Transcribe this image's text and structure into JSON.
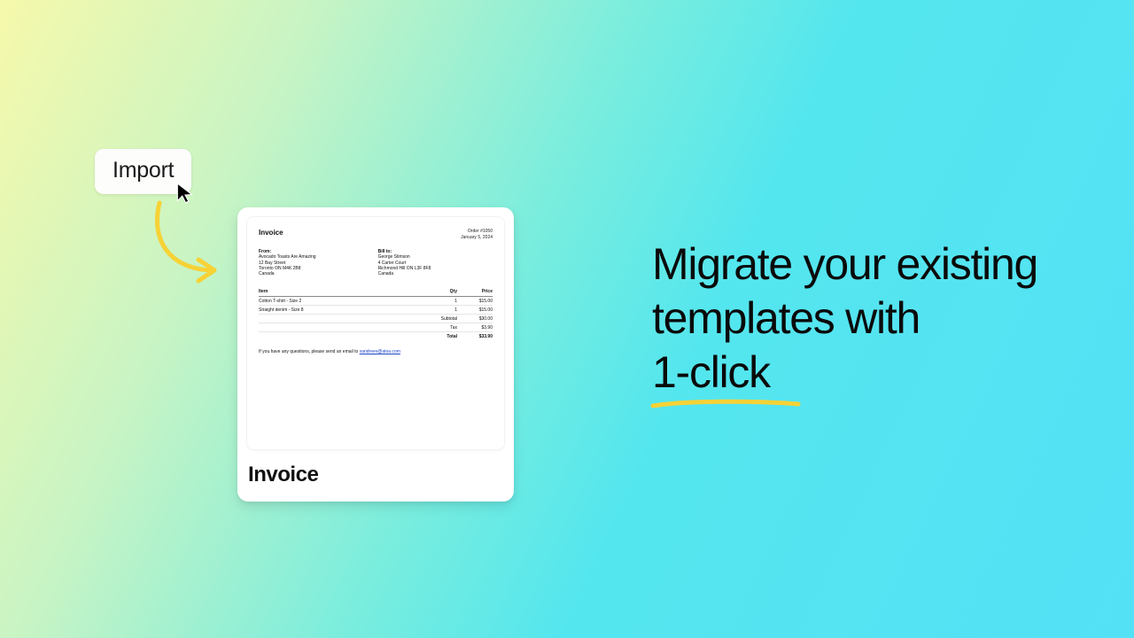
{
  "import_button": {
    "label": "Import"
  },
  "card": {
    "title": "Invoice"
  },
  "invoice": {
    "title": "Invoice",
    "order": "Order #1050",
    "date": "January 5, 2024",
    "from_label": "From:",
    "from": {
      "name": "Avocado Toasts Are Amazing",
      "line1": "12 Bay Street",
      "line2": "Toronto ON M4K 2B8",
      "country": "Canada"
    },
    "bill_label": "Bill to:",
    "bill": {
      "name": "George Stimson",
      "line1": "4 Carter Court",
      "line2": "Richmond Hill ON L3F 8F8",
      "country": "Canada"
    },
    "columns": {
      "item": "Item",
      "qty": "Qty",
      "price": "Price"
    },
    "lines": [
      {
        "item": "Cotton T-shirt - Size 2",
        "qty": "1",
        "price": "$15.00"
      },
      {
        "item": "Straight denim - Size 8",
        "qty": "1",
        "price": "$15.00"
      }
    ],
    "summary": {
      "subtotal_label": "Subtotal",
      "subtotal": "$30.00",
      "tax_label": "Tax",
      "tax": "$3.90",
      "total_label": "Total",
      "total": "$33.90"
    },
    "footer_text": "If you have any questions, please send an email to ",
    "footer_email": "xandreev@atoa.com"
  },
  "headline": {
    "line1": "Migrate your existing",
    "line2": "templates with",
    "highlight": "1-click"
  }
}
